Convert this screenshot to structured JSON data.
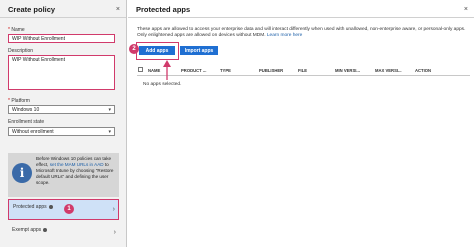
{
  "left": {
    "title": "Create policy",
    "close": "×",
    "name_label": "Name",
    "name_value": "WIP Without Enrollment",
    "desc_label": "Description",
    "desc_value": "WIP Without Enrollment",
    "platform_label": "Platform",
    "platform_value": "Windows 10",
    "enroll_label": "Enrollment state",
    "enroll_value": "Without enrollment",
    "required_mark": "*",
    "select_chevron": "▾",
    "info_icon": "i",
    "info_text_1": "Before Windows 10 policies can take effect, ",
    "info_link": "set the MAM URLs in AAD",
    "info_text_2": " to Microsoft Intune by choosing \"Restore default URLs\" and defining the user scope.",
    "nav_protected": "Protected apps",
    "nav_exempt": "Exempt apps",
    "nav_chevron": "›",
    "badge_1": "1"
  },
  "right": {
    "title": "Protected apps",
    "close": "×",
    "desc_1": "These apps are allowed to access your enterprise data and will interact differently when used with unallowed, non-enterprise aware, or personal-only apps. Only enlightened apps are allowed on devices without MDM. ",
    "desc_link": "Learn more here",
    "add_label": "Add apps",
    "import_label": "Import apps",
    "badge_2": "2",
    "columns": [
      "NAME",
      "PRODUCT ...",
      "TYPE",
      "PUBLISHER",
      "FILE",
      "MIN VERSI...",
      "MAX VERSI...",
      "ACTION"
    ],
    "empty_text": "No apps selected."
  },
  "colors": {
    "accent": "#1f6fd2",
    "highlight": "#d13a6b",
    "selected_bg": "#cfe1f7"
  }
}
